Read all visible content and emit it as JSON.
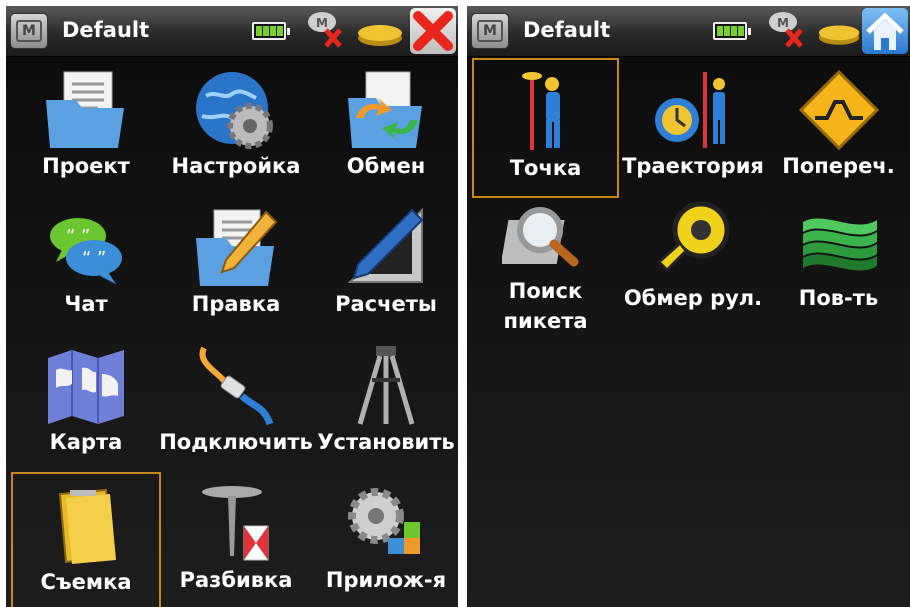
{
  "left": {
    "title": "Default",
    "apps": [
      {
        "label": "Проект",
        "icon": "folder-document-icon"
      },
      {
        "label": "Настройка",
        "icon": "globe-gear-icon"
      },
      {
        "label": "Обмен",
        "icon": "folder-exchange-icon"
      },
      {
        "label": "Чат",
        "icon": "chat-bubbles-icon"
      },
      {
        "label": "Правка",
        "icon": "folder-edit-icon"
      },
      {
        "label": "Расчеты",
        "icon": "ruler-pencil-icon"
      },
      {
        "label": "Карта",
        "icon": "world-map-icon"
      },
      {
        "label": "Подключить",
        "icon": "cable-icon"
      },
      {
        "label": "Установить",
        "icon": "tripod-icon"
      },
      {
        "label": "Съемка",
        "icon": "survey-notebook-icon"
      },
      {
        "label": "Разбивка",
        "icon": "stakeout-nail-icon"
      },
      {
        "label": "Прилож-я",
        "icon": "gear-blocks-icon"
      }
    ],
    "selected": "Съемка"
  },
  "right": {
    "title": "Default",
    "apps": [
      {
        "label": "Точка",
        "icon": "surveyor-pole-icon"
      },
      {
        "label": "Траектория",
        "icon": "surveyor-clock-icon"
      },
      {
        "label": "Попереч.",
        "icon": "cross-section-sign-icon"
      },
      {
        "label_lines": [
          "Поиск",
          "пикета"
        ],
        "icon": "magnifier-search-icon"
      },
      {
        "label": "Обмер рул.",
        "icon": "tape-measure-icon"
      },
      {
        "label": "Пов-ть",
        "icon": "surface-layers-icon"
      }
    ],
    "selected": "Точка"
  },
  "colors": {
    "accent": "#c8861c",
    "battery": "#7bd12b",
    "close": "#e8261c",
    "home": "#2f8be0"
  }
}
